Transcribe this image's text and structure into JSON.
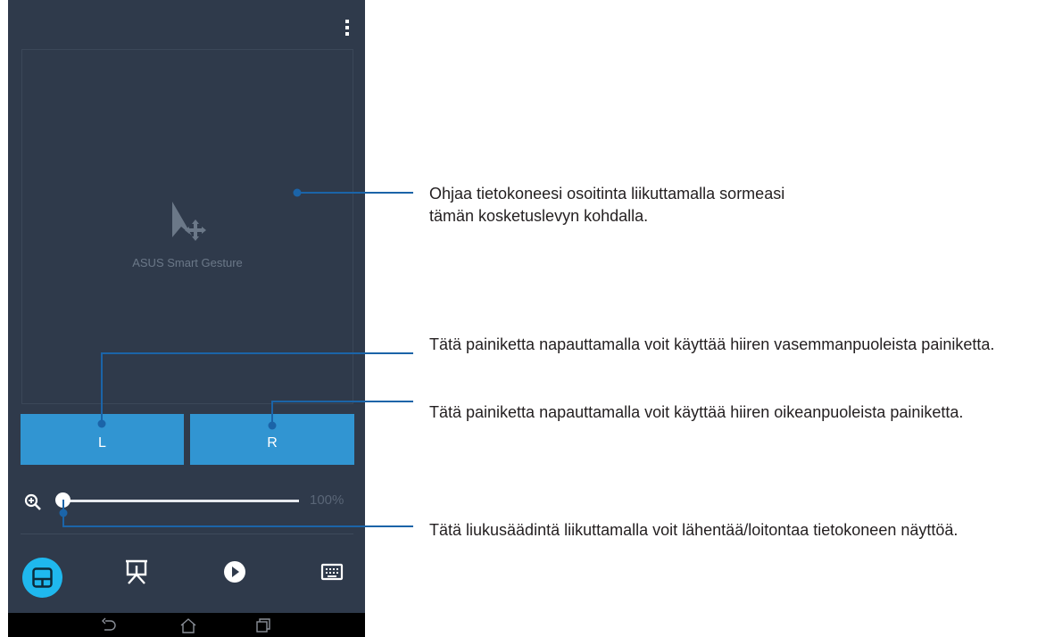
{
  "touchpad": {
    "label": "ASUS Smart Gesture",
    "icon": "pointer-move-icon"
  },
  "buttons": {
    "left_label": "L",
    "right_label": "R"
  },
  "zoom": {
    "icon": "zoom-in-icon",
    "value_text": "100%",
    "slider_fraction": 0.0
  },
  "tabs": [
    {
      "icon": "touchpad-icon",
      "active": true
    },
    {
      "icon": "presentation-icon",
      "active": false
    },
    {
      "icon": "play-icon",
      "active": false
    },
    {
      "icon": "keyboard-icon",
      "active": false
    }
  ],
  "system_nav": [
    "back-icon",
    "home-icon",
    "recents-icon"
  ],
  "callouts": {
    "touchpad": "Ohjaa tietokoneesi osoitinta liikuttamalla sormeasi tämän kosketuslevyn kohdalla.",
    "left_button": "Tätä painiketta napauttamalla voit käyttää hiiren vasemmanpuoleista painiketta.",
    "right_button": "Tätä painiketta napauttamalla voit käyttää hiiren oikeanpuoleista painiketta.",
    "zoom_slider": "Tätä liukusäädintä liikuttamalla voit lähentää/loitontaa tietokoneen näyttöä."
  },
  "colors": {
    "app_background": "#2f3a4b",
    "accent_button": "#3195d2",
    "active_tab": "#1fb8ee",
    "leader_line": "#1b64a8"
  }
}
